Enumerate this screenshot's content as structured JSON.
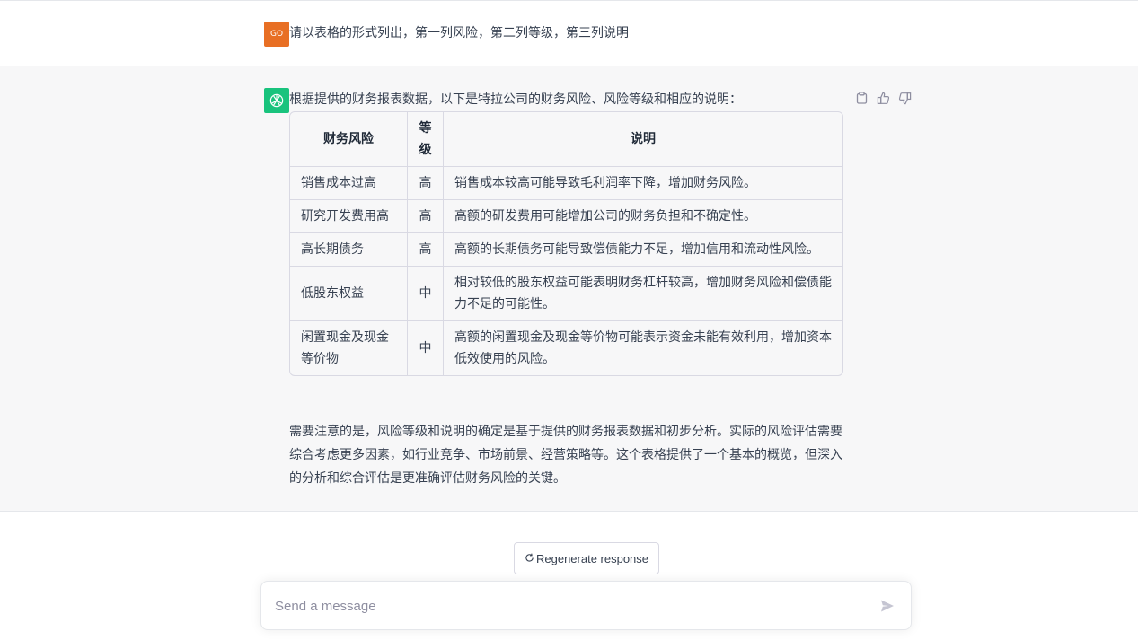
{
  "user_message": {
    "avatar_initials": "GO",
    "text": "请以表格的形式列出，第一列风险，第二列等级，第三列说明"
  },
  "assistant_message": {
    "intro": "根据提供的财务报表数据，以下是特拉公司的财务风险、风险等级和相应的说明：",
    "table": {
      "headers": [
        "财务风险",
        "等级",
        "说明"
      ],
      "rows": [
        [
          "销售成本过高",
          "高",
          "销售成本较高可能导致毛利润率下降，增加财务风险。"
        ],
        [
          "研究开发费用高",
          "高",
          "高额的研发费用可能增加公司的财务负担和不确定性。"
        ],
        [
          "高长期债务",
          "高",
          "高额的长期债务可能导致偿债能力不足，增加信用和流动性风险。"
        ],
        [
          "低股东权益",
          "中",
          "相对较低的股东权益可能表明财务杠杆较高，增加财务风险和偿债能力不足的可能性。"
        ],
        [
          "闲置现金及现金等价物",
          "中",
          "高额的闲置现金及现金等价物可能表示资金未能有效利用，增加资本低效使用的风险。"
        ]
      ]
    },
    "note": "需要注意的是，风险等级和说明的确定是基于提供的财务报表数据和初步分析。实际的风险评估需要综合考虑更多因素，如行业竞争、市场前景、经营策略等。这个表格提供了一个基本的概览，但深入的分析和综合评估是更准确评估财务风险的关键。"
  },
  "regenerate_label": "Regenerate response",
  "composer": {
    "placeholder": "Send a message"
  },
  "colors": {
    "user_avatar": "#e86f24",
    "assistant_avatar": "#19c37d",
    "assistant_bg": "#f7f7f8"
  }
}
